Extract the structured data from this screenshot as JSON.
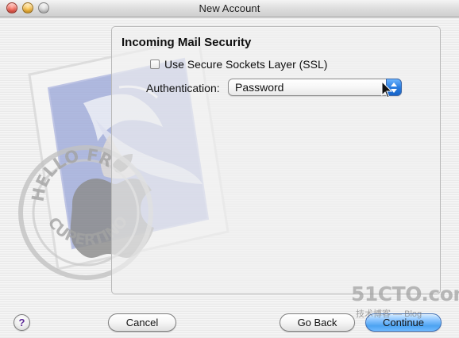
{
  "window": {
    "title": "New Account"
  },
  "section": {
    "title": "Incoming Mail Security",
    "ssl_label": "Use Secure Sockets Layer (SSL)",
    "ssl_checked": false,
    "authentication_label": "Authentication:",
    "authentication_value": "Password"
  },
  "buttons": {
    "help": "?",
    "cancel": "Cancel",
    "go_back": "Go Back",
    "continue": "Continue"
  },
  "background": {
    "stamp_text_top": "HELLO FR",
    "stamp_text_bottom": "CUPERTINO, CA"
  },
  "watermark": {
    "main": "51CTO.com",
    "sub": "技术博客 — Blog"
  },
  "colors": {
    "accent_blue": "#4da3f1",
    "select_blue": "#2a7de0",
    "window_bg": "#ececec"
  },
  "icons": {
    "close": "close-window-icon",
    "minimize": "minimize-window-icon",
    "zoom": "zoom-window-icon",
    "cursor": "mouse-pointer-icon",
    "stamp": "mail-stamp-icon",
    "apple": "apple-logo-icon"
  }
}
